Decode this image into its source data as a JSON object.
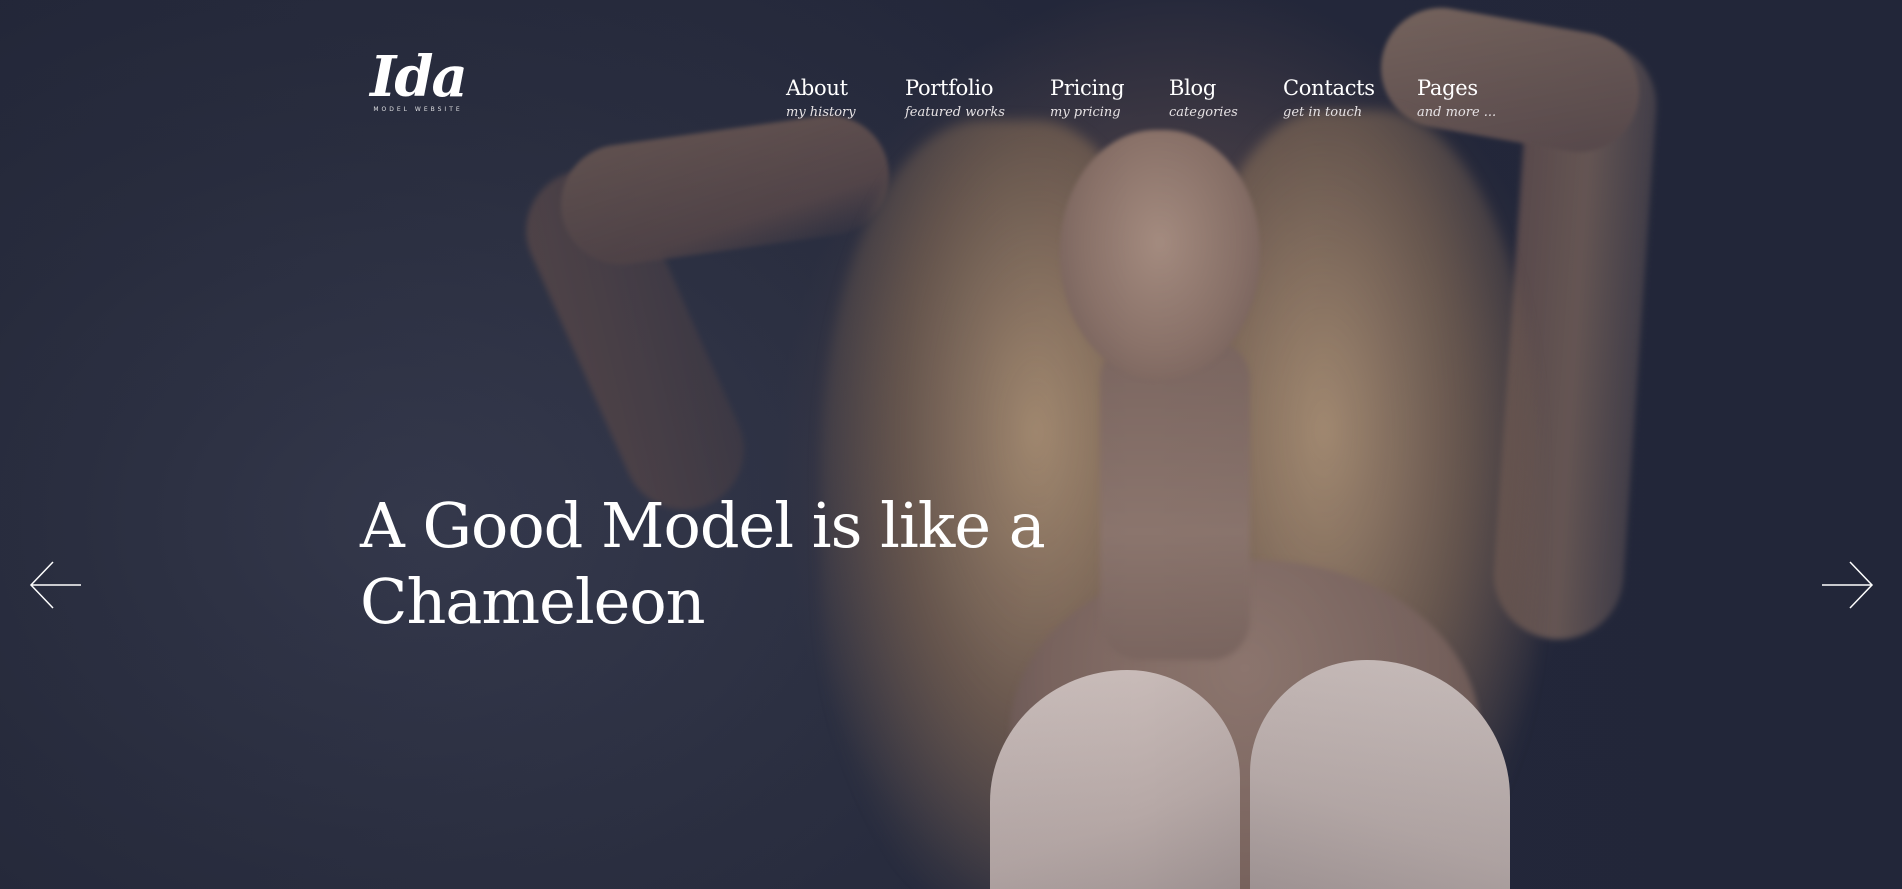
{
  "logo": {
    "script": "Ida",
    "tagline": "MODEL WEBSITE"
  },
  "nav": {
    "items": [
      {
        "label": "About",
        "sub": "my history"
      },
      {
        "label": "Portfolio",
        "sub": "featured works"
      },
      {
        "label": "Pricing",
        "sub": "my pricing"
      },
      {
        "label": "Blog",
        "sub": "categories"
      },
      {
        "label": "Contacts",
        "sub": "get in touch"
      },
      {
        "label": "Pages",
        "sub": "and more ..."
      }
    ]
  },
  "hero": {
    "headline_line1": "A Good Model is like a",
    "headline_line2": "Chameleon",
    "prev_icon": "arrow-left-icon",
    "next_icon": "arrow-right-icon"
  },
  "colors": {
    "background": "#2a2e3d",
    "text": "#ffffff"
  }
}
